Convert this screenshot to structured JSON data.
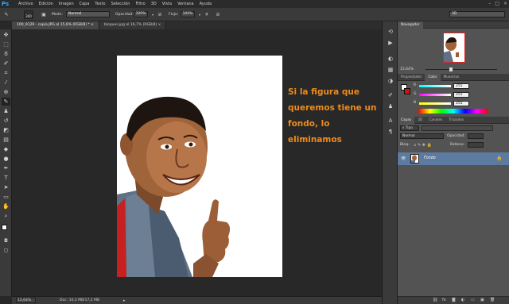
{
  "app": {
    "logo": "Ps"
  },
  "menu": [
    "Archivo",
    "Edición",
    "Imagen",
    "Capa",
    "Texto",
    "Selección",
    "Filtro",
    "3D",
    "Vista",
    "Ventana",
    "Ayuda"
  ],
  "options": {
    "brush_size": "300",
    "mode_label": "Modo:",
    "mode_value": "Normal",
    "opacity_label": "Opacidad:",
    "opacity_value": "100%",
    "flow_label": "Flujo:",
    "flow_value": "100%",
    "workspace": "3D"
  },
  "tabs": [
    {
      "label": "100_9129 - copia.JPG al 15,6% (RGB/8) *",
      "close": "×"
    },
    {
      "label": "bloques.jpg al 16,7% (RGB/8)",
      "close": "×"
    }
  ],
  "canvas": {
    "caption": "Si la figura que queremos tiene un fondo, lo eliminamos"
  },
  "status": {
    "zoom": "15,64%",
    "doc_info": "Doc: 34,3 MB/17,2 MB"
  },
  "navigator": {
    "tab": "Navegador",
    "zoom": "15,64%"
  },
  "color_panel": {
    "tabs": [
      "Propiedades",
      "Color",
      "Muestras"
    ],
    "r_label": "R",
    "g_label": "G",
    "b_label": "B",
    "r_value": "255",
    "g_value": "255",
    "b_value": "255"
  },
  "layers_panel": {
    "tabs": [
      "Capas",
      "3D",
      "Canales",
      "Trazados"
    ],
    "filter": "Tipo",
    "blend_mode": "Normal",
    "opacity_label": "Opacidad:",
    "lock_label": "Bloq.:",
    "fill_label": "Relleno:",
    "layer_name": "Fondo"
  },
  "colors": {
    "accent_text": "#ee8b1a",
    "selected_layer": "#5d7aa0",
    "photoshop_blue": "#31a8ff"
  }
}
